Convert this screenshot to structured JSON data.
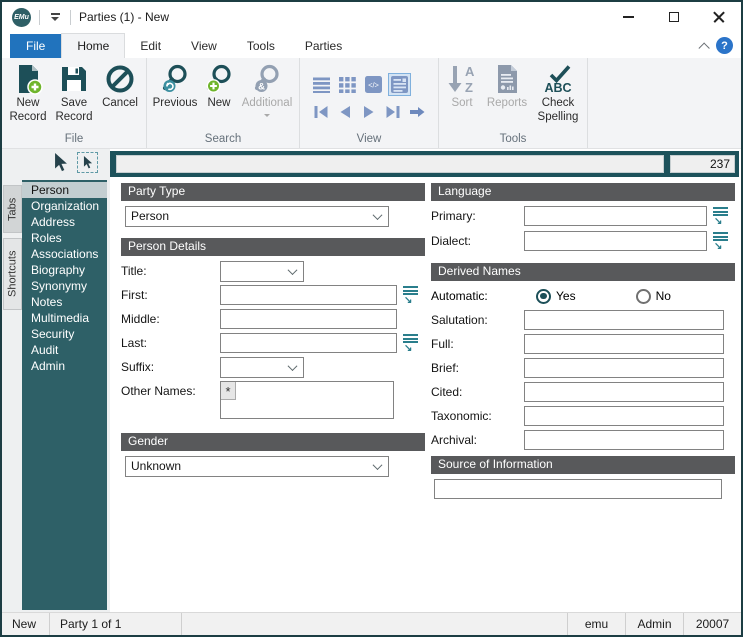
{
  "window": {
    "logo": "EMu",
    "title": "Parties (1) - New"
  },
  "tabs": {
    "items": [
      "File",
      "Home",
      "Edit",
      "View",
      "Tools",
      "Parties"
    ],
    "active": "Home"
  },
  "ribbon": {
    "file_group": {
      "label": "File",
      "new_record": "New Record",
      "save_record": "Save Record",
      "cancel": "Cancel"
    },
    "search_group": {
      "label": "Search",
      "previous": "Previous",
      "new": "New",
      "additional": "Additional"
    },
    "view_group": {
      "label": "View"
    },
    "tools_group": {
      "label": "Tools",
      "sort": "Sort",
      "reports": "Reports",
      "check_spelling": "Check Spelling"
    }
  },
  "icon_glyphs": {
    "sort_a": "A",
    "sort_z": "Z",
    "check_abc": "ABC",
    "additional_amp": "&",
    "code_view": "</>",
    "help": "?",
    "grid_marker": "*",
    "lookup_arrow": "↘"
  },
  "summary_bar": {
    "count": "237"
  },
  "dock": {
    "tabs": [
      {
        "label": "Tabs",
        "selected": true
      },
      {
        "label": "Shortcuts"
      }
    ]
  },
  "sidebar": {
    "items": [
      {
        "label": "Person",
        "selected": true
      },
      {
        "label": "Organization"
      },
      {
        "label": "Address"
      },
      {
        "label": "Roles"
      },
      {
        "label": "Associations"
      },
      {
        "label": "Biography"
      },
      {
        "label": "Synonymy"
      },
      {
        "label": "Notes"
      },
      {
        "label": "Multimedia"
      },
      {
        "label": "Security"
      },
      {
        "label": "Audit"
      },
      {
        "label": "Admin"
      }
    ]
  },
  "form": {
    "party_type": {
      "header": "Party Type",
      "value": "Person"
    },
    "person_details": {
      "header": "Person Details",
      "title_label": "Title:",
      "first_label": "First:",
      "middle_label": "Middle:",
      "last_label": "Last:",
      "suffix_label": "Suffix:",
      "other_names_label": "Other Names:"
    },
    "gender": {
      "header": "Gender",
      "value": "Unknown"
    },
    "language": {
      "header": "Language",
      "primary_label": "Primary:",
      "dialect_label": "Dialect:"
    },
    "derived_names": {
      "header": "Derived Names",
      "automatic_label": "Automatic:",
      "yes": "Yes",
      "no": "No",
      "salutation_label": "Salutation:",
      "full_label": "Full:",
      "brief_label": "Brief:",
      "cited_label": "Cited:",
      "taxonomic_label": "Taxonomic:",
      "archival_label": "Archival:"
    },
    "source": {
      "header": "Source of Information"
    }
  },
  "status_bar": {
    "mode": "New",
    "record": "Party 1 of 1",
    "right": [
      "emu",
      "Admin",
      "20007"
    ]
  },
  "colors": {
    "teal_dark": "#1d4f58",
    "teal_panel": "#2e6067",
    "summary_teal": "#1d525b",
    "header_gray": "#58595b",
    "green": "#6fb52c",
    "file_tab_blue": "#2173bd",
    "view_icon_blue": "#7e96c3"
  }
}
